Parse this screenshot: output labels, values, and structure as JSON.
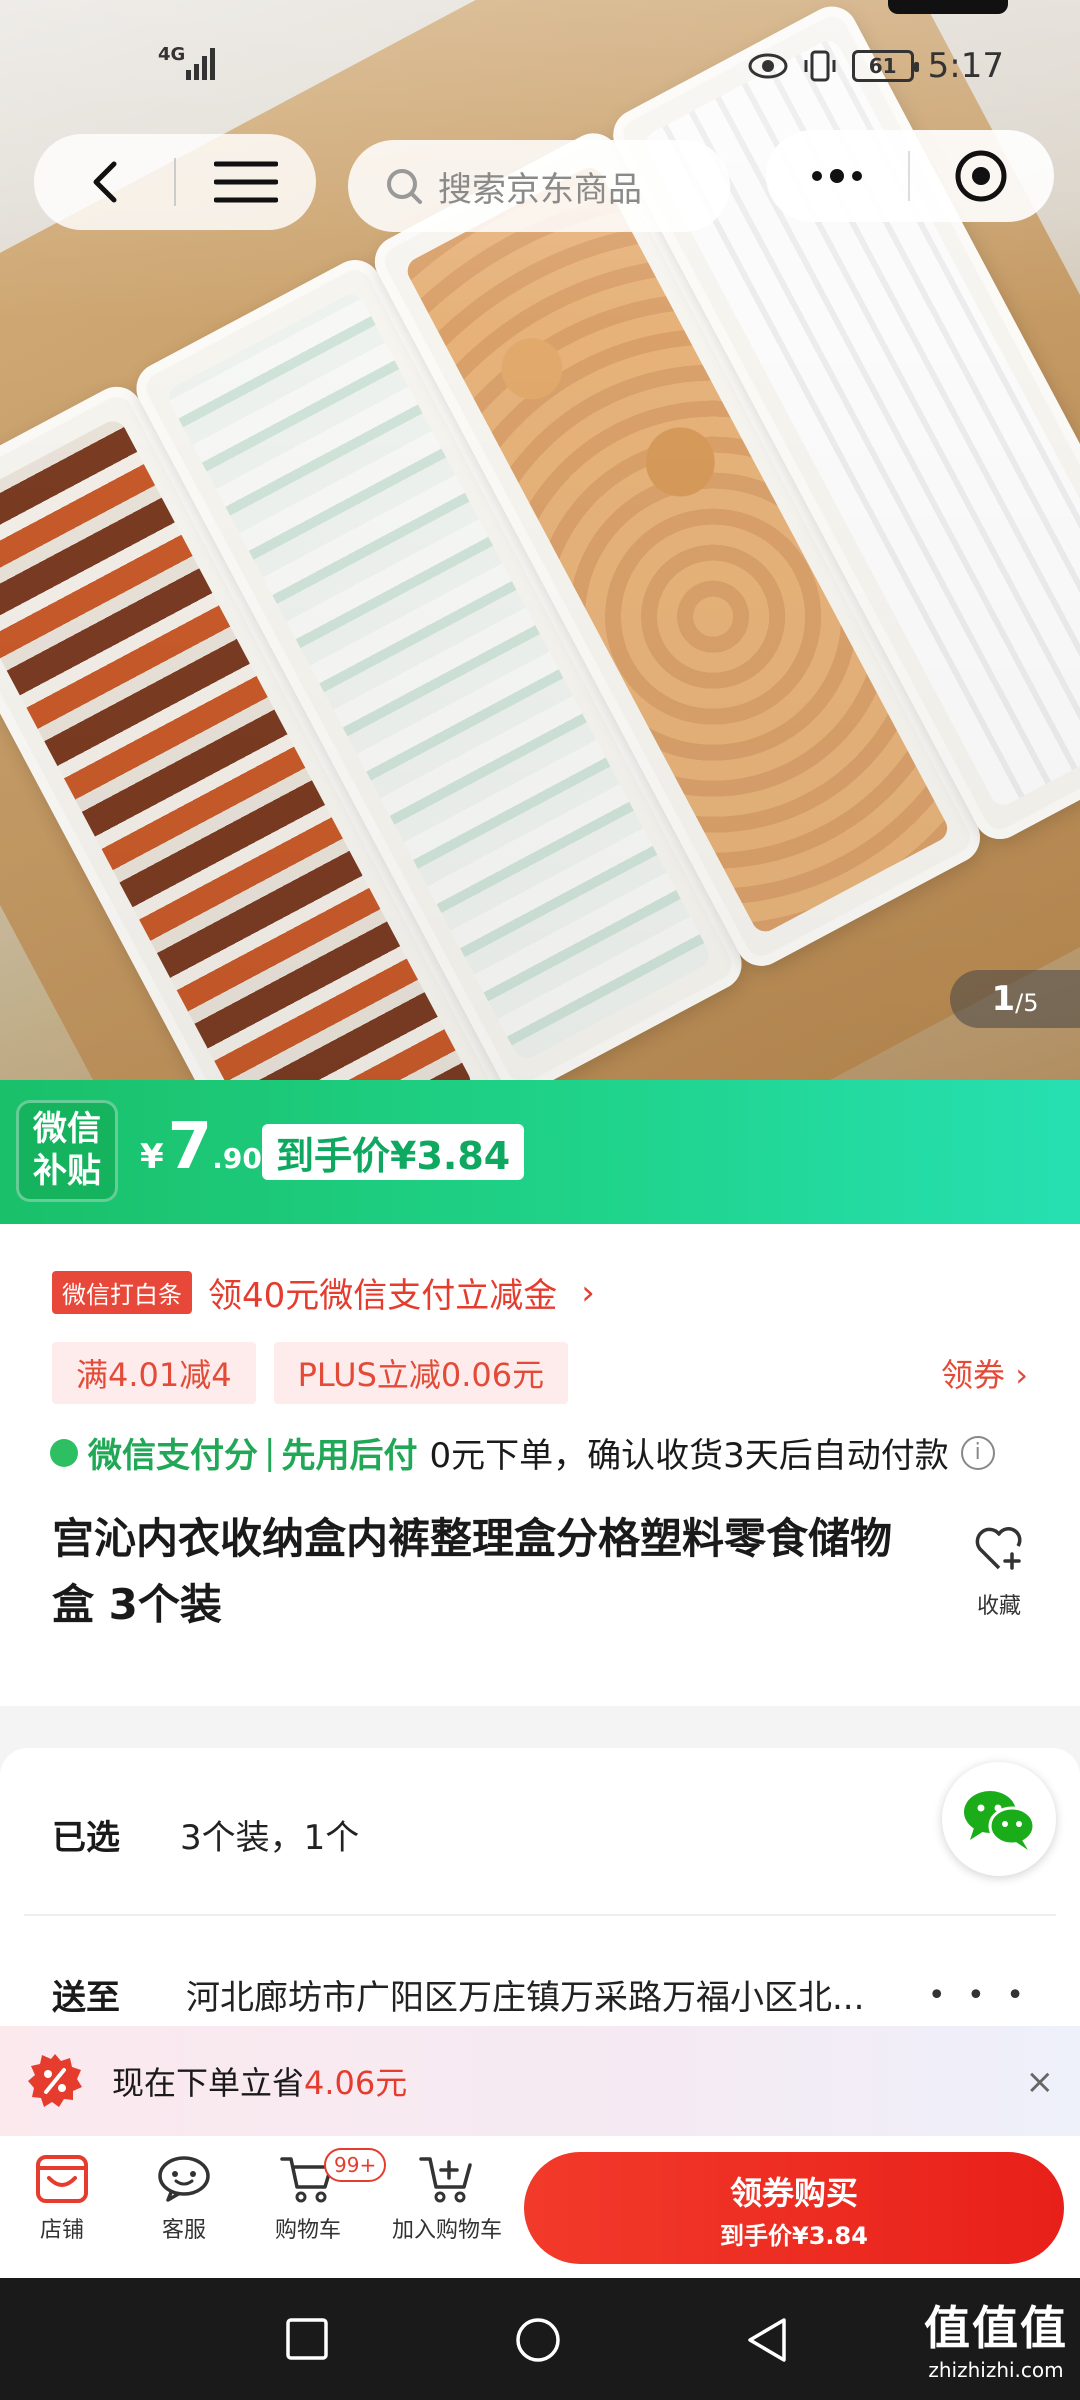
{
  "status_bar": {
    "network": "4G",
    "battery": "61",
    "time": "5:17"
  },
  "nav": {
    "search_placeholder": "搜索京东商品"
  },
  "gallery": {
    "current": "1",
    "total": "/5"
  },
  "price_banner": {
    "badge_line1": "微信",
    "badge_line2": "补贴",
    "currency": "¥",
    "price_int": "7",
    "price_dec": ".90",
    "final_price": "到手价¥3.84"
  },
  "promo": {
    "tag": "微信打白条",
    "text": "领40元微信支付立减金",
    "arrow": "›"
  },
  "coupons": {
    "items": [
      "满4.01减4",
      "PLUS立减0.06元"
    ],
    "get_label": "领券 ›"
  },
  "pay_later": {
    "brand": "微信支付分",
    "separator": "|",
    "label": "先用后付",
    "desc": "0元下单，确认收货3天后自动付款",
    "info": "i"
  },
  "product": {
    "title": "宫沁内衣收纳盒内裤整理盒分格塑料零食储物盒 3个装",
    "favorite_label": "收藏"
  },
  "spec": {
    "selected_label": "已选",
    "selected_value": "3个装，1个",
    "ship_label": "送至",
    "ship_value": "河北廊坊市广阳区万庄镇万采路万福小区北...",
    "more": "• • •"
  },
  "savings": {
    "prefix": "现在下单立省",
    "amount": "4.06元",
    "close": "×"
  },
  "actions": {
    "store": "店铺",
    "service": "客服",
    "cart": "购物车",
    "cart_badge": "99+",
    "add_cart": "加入购物车",
    "buy_line1": "领券购买",
    "buy_line2": "到手价¥3.84"
  },
  "watermark": {
    "logo": "值值值",
    "site": "zhizhizhi.com"
  },
  "colors": {
    "accent_red": "#e63c2e",
    "wechat_green": "#1ac06a"
  }
}
